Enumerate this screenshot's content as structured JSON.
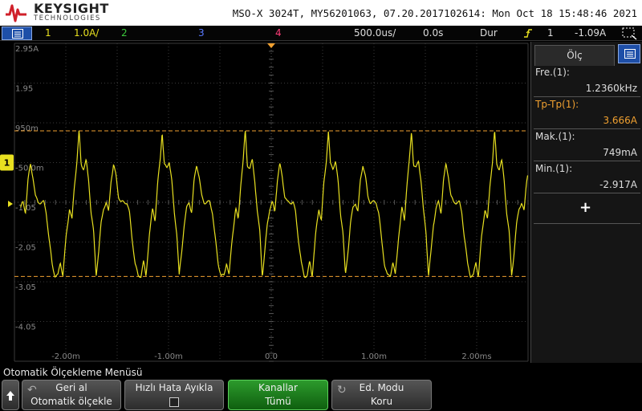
{
  "banner": {
    "brand": "KEYSIGHT",
    "brand_sub": "TECHNOLOGIES",
    "instrument_info": "MSO-X 3024T, MY56201063, 07.20.2017102614: Mon Oct 18 15:48:46 2021"
  },
  "status": {
    "ch1_num": "1",
    "ch1_scale": "1.0A/",
    "ch2_num": "2",
    "ch3_num": "3",
    "ch4_num": "4",
    "timebase": "500.0us/",
    "delay": "0.0s",
    "acq_mode": "Dur",
    "trigger_src": "1",
    "trigger_level": "-1.09A"
  },
  "graticule": {
    "y_labels": [
      "2.95A",
      "1.95",
      "950m",
      "-50.0m",
      "-1.05",
      "-2.05",
      "-3.05",
      "-4.05"
    ],
    "x_labels": [
      "-2.00m",
      "-1.00m",
      "0.0",
      "1.00m",
      "2.00ms"
    ]
  },
  "measurements": {
    "tab_label": "Ölç",
    "items": [
      {
        "name": "Fre.(1):",
        "value": "1.2360kHz",
        "highlight": false
      },
      {
        "name": "Tp-Tp(1):",
        "value": "3.666A",
        "highlight": true
      },
      {
        "name": "Mak.(1):",
        "value": "749mA",
        "highlight": false
      },
      {
        "name": "Min.(1):",
        "value": "-2.917A",
        "highlight": false
      }
    ],
    "add_label": "+"
  },
  "softmenu": {
    "title": "Otomatik Ölçekleme Menüsü",
    "keys": [
      {
        "line1": "Geri al",
        "line2": "Otomatik ölçekle"
      },
      {
        "line1": "Hızlı Hata Ayıkla",
        "line2": ""
      },
      {
        "line1": "Kanallar",
        "line2": "Tümü"
      },
      {
        "line1": "Ed. Modu",
        "line2": "Koru"
      }
    ]
  },
  "colors": {
    "ch1": "#e8e020",
    "cursor": "#f0a030",
    "ch2": "#3cc83c",
    "ch3": "#5a7aff",
    "ch4": "#ff3c78"
  },
  "icons": {
    "menu": "menu-icon",
    "trigger": "trigger-edge-icon",
    "zoom": "zoom-box-icon",
    "up": "arrow-up-icon"
  }
}
